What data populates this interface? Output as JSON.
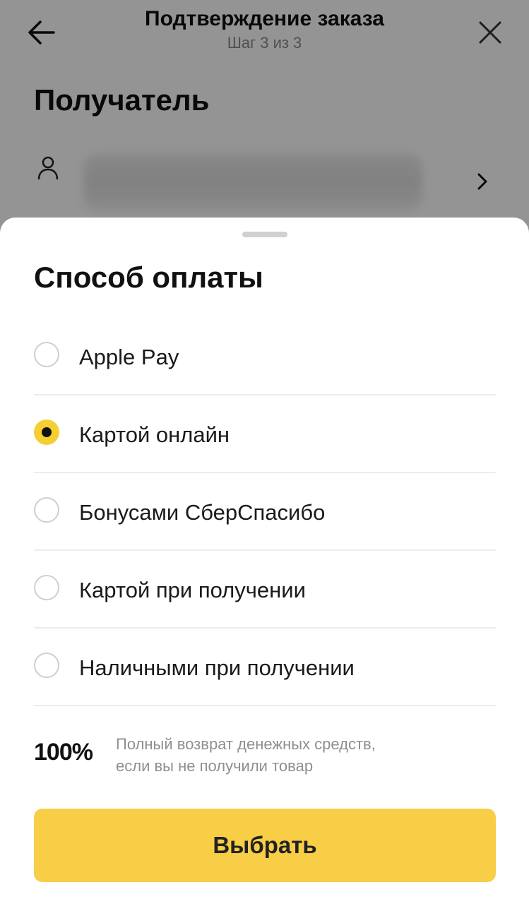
{
  "header": {
    "title": "Подтверждение заказа",
    "subtitle": "Шаг 3 из 3",
    "back_icon": "arrow-left-icon",
    "close_icon": "close-icon"
  },
  "recipient": {
    "heading": "Получатель",
    "icon": "person-icon",
    "chevron_icon": "chevron-right-icon"
  },
  "payment_sheet": {
    "title": "Способ оплаты",
    "options": [
      {
        "label": "Apple Pay",
        "selected": false
      },
      {
        "label": "Картой онлайн",
        "selected": true
      },
      {
        "label": "Бонусами СберСпасибо",
        "selected": false
      },
      {
        "label": "Картой при получении",
        "selected": false
      },
      {
        "label": "Наличными при получении",
        "selected": false
      }
    ],
    "guarantee": {
      "percent": "100%",
      "line1": "Полный возврат денежных средств,",
      "line2": "если вы не получили товар"
    },
    "select_button": "Выбрать"
  },
  "colors": {
    "accent": "#f7ce46",
    "radio_selected": "#f5ce32",
    "overlay": "rgba(0,0,0,0.42)"
  }
}
